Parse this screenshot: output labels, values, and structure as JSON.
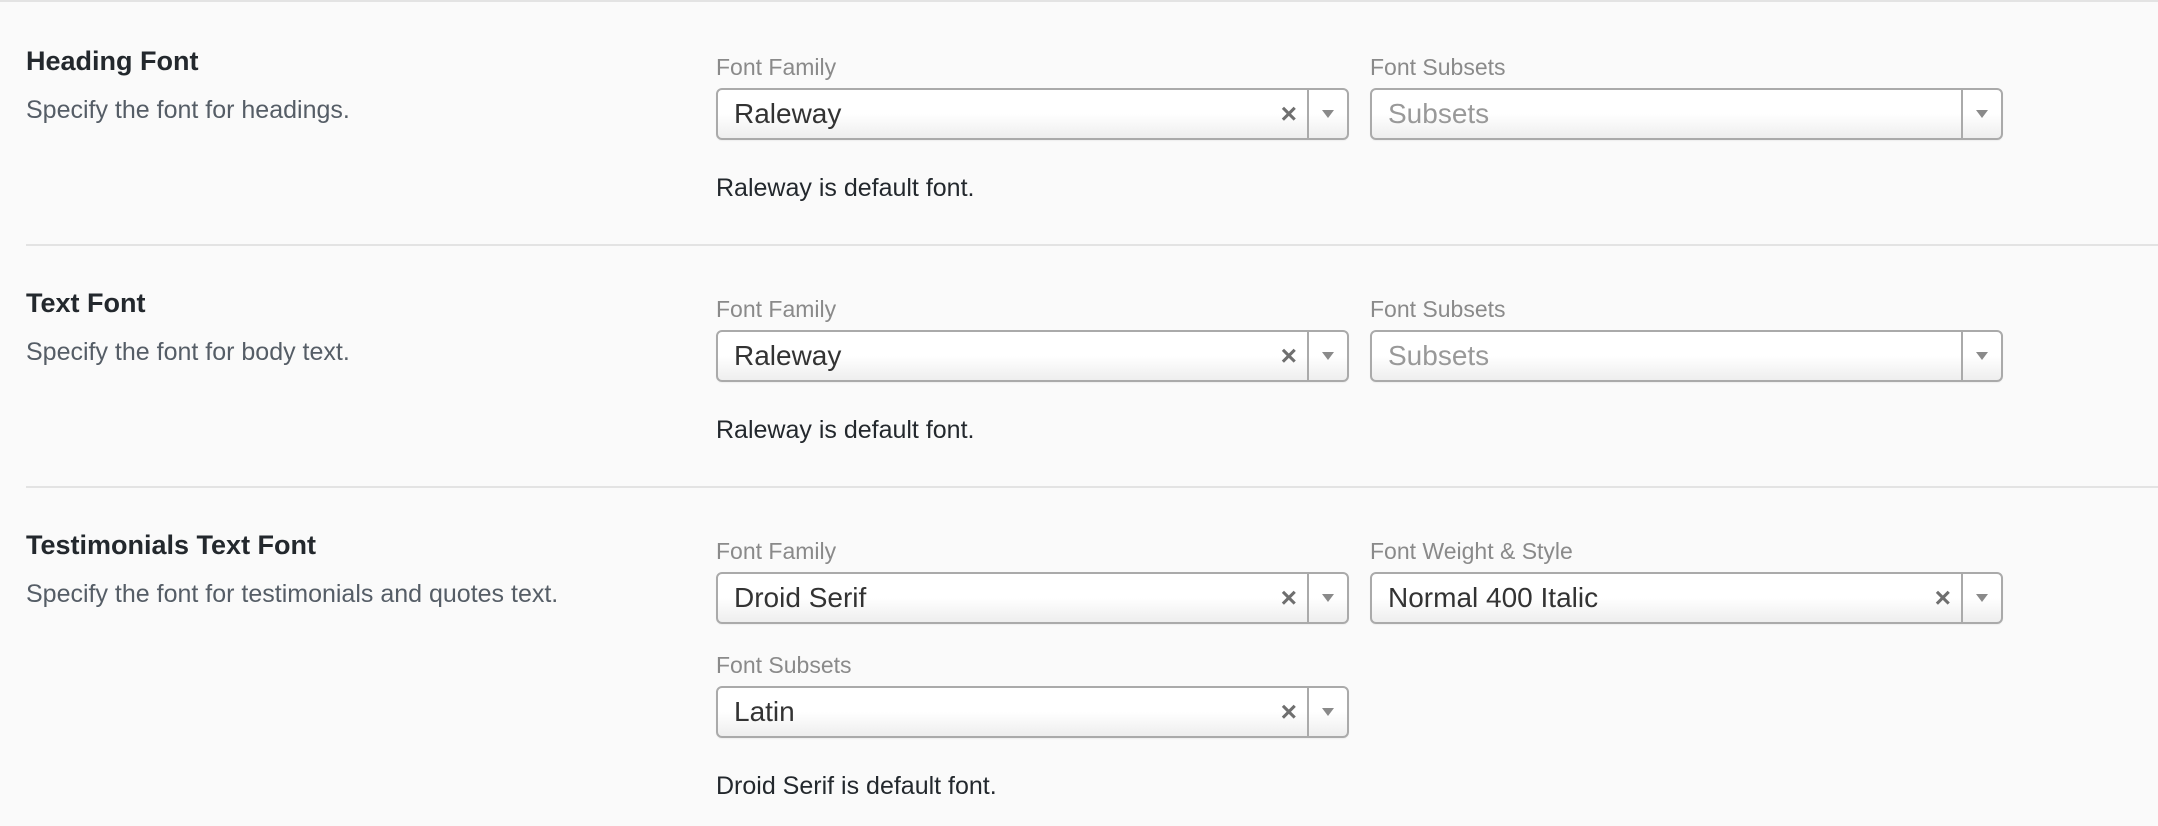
{
  "sections": [
    {
      "title": "Heading Font",
      "description": "Specify the font for headings.",
      "font_family_label": "Font Family",
      "font_family_value": "Raleway",
      "font_subsets_label": "Font Subsets",
      "font_subsets_placeholder": "Subsets",
      "note": "Raleway is default font."
    },
    {
      "title": "Text Font",
      "description": "Specify the font for body text.",
      "font_family_label": "Font Family",
      "font_family_value": "Raleway",
      "font_subsets_label": "Font Subsets",
      "font_subsets_placeholder": "Subsets",
      "note": "Raleway is default font."
    },
    {
      "title": "Testimonials Text Font",
      "description": "Specify the font for testimonials and quotes text.",
      "font_family_label": "Font Family",
      "font_family_value": "Droid Serif",
      "font_weight_label": "Font Weight & Style",
      "font_weight_value": "Normal 400 Italic",
      "font_subsets_label": "Font Subsets",
      "font_subsets_value": "Latin",
      "note": "Droid Serif is default font."
    }
  ],
  "icons": {
    "clear": "×",
    "dropdown": "chevron-down-icon"
  }
}
